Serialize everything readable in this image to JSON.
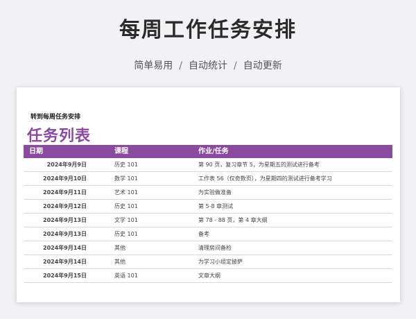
{
  "header": {
    "title": "每周工作任务安排",
    "subtitle_parts": [
      "简单易用",
      "自动统计",
      "自动更新"
    ],
    "separator": "/"
  },
  "sheet": {
    "link_label": "转到每周任务安排",
    "list_title": "任务列表",
    "columns": [
      "日期",
      "课程",
      "作业/任务"
    ],
    "rows": [
      {
        "date": "2024年9月9日",
        "course": "历史 101",
        "task": "第 90 页，复习章节 5，为星期五的测试进行备考"
      },
      {
        "date": "2024年9月10日",
        "course": "数学 101",
        "task": "工作表 56（仅奇数页），为星期四的测试进行备考学习"
      },
      {
        "date": "2024年9月11日",
        "course": "艺术 101",
        "task": "为实验做准备"
      },
      {
        "date": "2024年9月12日",
        "course": "历史 101",
        "task": "第 5-8 章测试"
      },
      {
        "date": "2024年9月13日",
        "course": "文学 101",
        "task": "第 78 - 88 页，第 4 章大纲"
      },
      {
        "date": "2024年9月13日",
        "course": "历史 101",
        "task": "备考"
      },
      {
        "date": "2024年9月14日",
        "course": "其他",
        "task": "清理房间备检"
      },
      {
        "date": "2024年9月14日",
        "course": "其他",
        "task": "为学习小组定披萨"
      },
      {
        "date": "2024年9月15日",
        "course": "英语 101",
        "task": "文章大纲"
      }
    ]
  },
  "colors": {
    "accent": "#8a4a9e",
    "background": "#f2f2f4"
  }
}
